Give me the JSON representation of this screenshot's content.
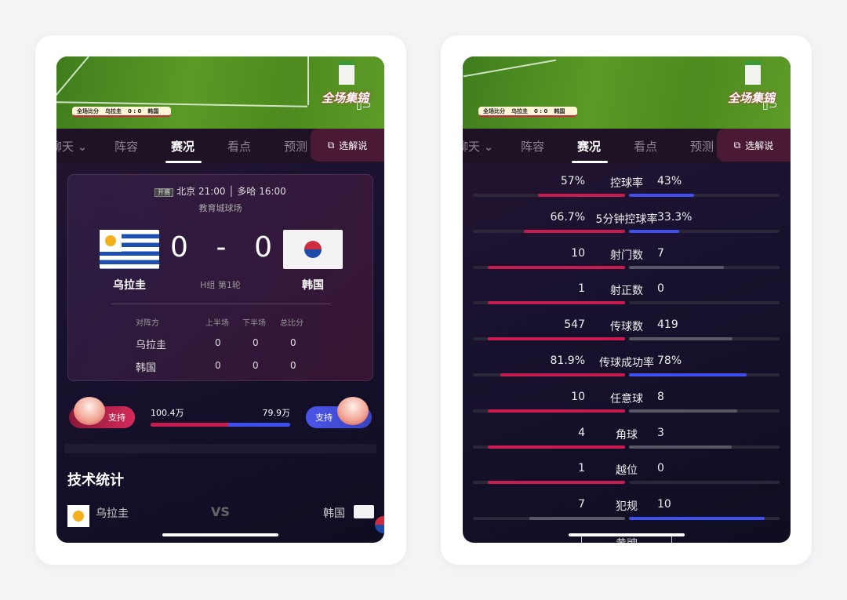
{
  "colors": {
    "home": "#c81c50",
    "away": "#3f4ff0",
    "neutral": "#5b5766"
  },
  "video": {
    "scorebug": {
      "label": "全场比分",
      "home": "乌拉圭",
      "score": "0 : 0",
      "away": "韩国"
    },
    "logo_text": "全场集锦",
    "rotate_icon": "rotate-screen-icon"
  },
  "tabs": [
    {
      "label": "聊天"
    },
    {
      "label": "阵容"
    },
    {
      "label": "赛况"
    },
    {
      "label": "看点"
    },
    {
      "label": "预测"
    }
  ],
  "active_tab": "赛况",
  "commentary_button": "选解说",
  "match": {
    "badge": "开赛",
    "beijing_time": "北京 21:00",
    "local_time": "多哈 16:00",
    "venue": "教育城球场",
    "home": "乌拉圭",
    "away": "韩国",
    "home_score": "0",
    "away_score": "0",
    "separator": "-",
    "round": "H组 第1轮",
    "table": {
      "headers": [
        "对阵方",
        "上半场",
        "下半场",
        "总比分"
      ],
      "rows": [
        [
          "乌拉圭",
          "0",
          "0",
          "0"
        ],
        [
          "韩国",
          "0",
          "0",
          "0"
        ]
      ]
    }
  },
  "support": {
    "label": "支持",
    "home_votes": "100.4万",
    "away_votes": "79.9万",
    "home_share": 0.557
  },
  "tech_stats": {
    "title": "技术统计",
    "home": "乌拉圭",
    "vs": "VS",
    "away": "韩国"
  },
  "stats": [
    {
      "label": "控球率",
      "home": "57%",
      "away": "43%",
      "home_fill": 0.57,
      "away_fill": 0.43,
      "home_hl": true,
      "away_hl": true
    },
    {
      "label": "5分钟控球率",
      "home": "66.7%",
      "away": "33.3%",
      "home_fill": 0.667,
      "away_fill": 0.333,
      "home_hl": true,
      "away_hl": true
    },
    {
      "label": "射门数",
      "home": "10",
      "away": "7",
      "home_fill": 0.9,
      "away_fill": 0.63,
      "home_hl": true,
      "away_hl": false
    },
    {
      "label": "射正数",
      "home": "1",
      "away": "0",
      "home_fill": 0.9,
      "away_fill": 0,
      "home_hl": true,
      "away_hl": false
    },
    {
      "label": "传球数",
      "home": "547",
      "away": "419",
      "home_fill": 0.9,
      "away_fill": 0.69,
      "home_hl": true,
      "away_hl": false
    },
    {
      "label": "传球成功率",
      "home": "81.9%",
      "away": "78%",
      "home_fill": 0.819,
      "away_fill": 0.78,
      "home_hl": true,
      "away_hl": true
    },
    {
      "label": "任意球",
      "home": "10",
      "away": "8",
      "home_fill": 0.9,
      "away_fill": 0.72,
      "home_hl": true,
      "away_hl": false
    },
    {
      "label": "角球",
      "home": "4",
      "away": "3",
      "home_fill": 0.9,
      "away_fill": 0.68,
      "home_hl": true,
      "away_hl": false
    },
    {
      "label": "越位",
      "home": "1",
      "away": "0",
      "home_fill": 0.9,
      "away_fill": 0,
      "home_hl": true,
      "away_hl": false
    },
    {
      "label": "犯规",
      "home": "7",
      "away": "10",
      "home_fill": 0.63,
      "away_fill": 0.9,
      "home_hl": false,
      "away_hl": true
    }
  ],
  "next_label": "黄牌"
}
